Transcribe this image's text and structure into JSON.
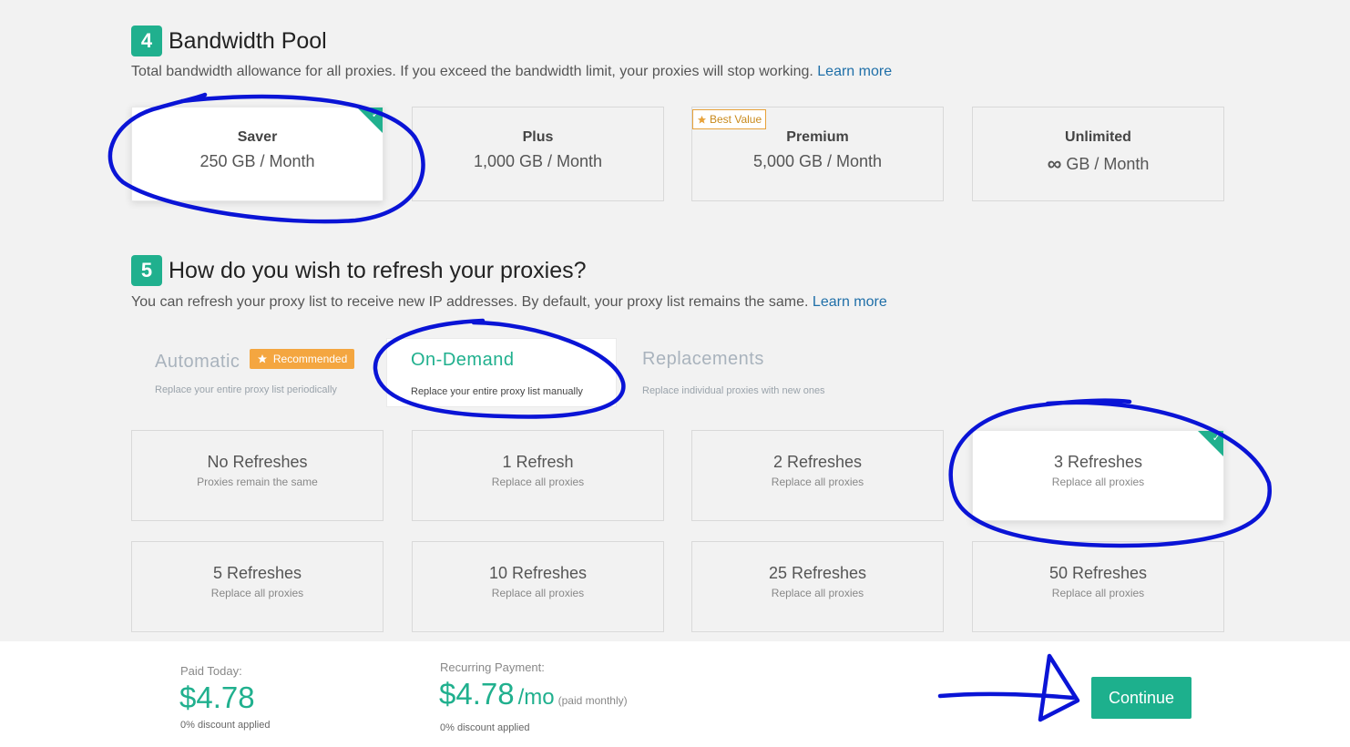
{
  "bandwidth": {
    "step": "4",
    "title": "Bandwidth Pool",
    "description": "Total bandwidth allowance for all proxies. If you exceed the bandwidth limit, your proxies will stop working.",
    "learn_more": "Learn more",
    "best_value_label": "Best Value",
    "plans": [
      {
        "name": "Saver",
        "amount": "250 GB / Month",
        "selected": true
      },
      {
        "name": "Plus",
        "amount": "1,000 GB / Month",
        "selected": false
      },
      {
        "name": "Premium",
        "amount": "5,000 GB / Month",
        "selected": false
      },
      {
        "name": "Unlimited",
        "amount_icon": "infinity-icon",
        "amount_text": "GB / Month",
        "selected": false
      }
    ]
  },
  "refresh": {
    "step": "5",
    "title": "How do you wish to refresh your proxies?",
    "description": "You can refresh your proxy list to receive new IP addresses. By default, your proxy list remains the same.",
    "learn_more": "Learn more",
    "tabs": [
      {
        "label": "Automatic",
        "sub": "Replace your entire proxy list periodically",
        "badge": "Recommended",
        "active": false
      },
      {
        "label": "On-Demand",
        "sub": "Replace your entire proxy list manually",
        "active": true
      },
      {
        "label": "Replacements",
        "sub": "Replace individual proxies with new ones",
        "active": false
      }
    ],
    "options": [
      {
        "name": "No Refreshes",
        "sub": "Proxies remain the same",
        "selected": false
      },
      {
        "name": "1 Refresh",
        "sub": "Replace all proxies",
        "selected": false
      },
      {
        "name": "2 Refreshes",
        "sub": "Replace all proxies",
        "selected": false
      },
      {
        "name": "3 Refreshes",
        "sub": "Replace all proxies",
        "selected": true
      },
      {
        "name": "5 Refreshes",
        "sub": "Replace all proxies",
        "selected": false
      },
      {
        "name": "10 Refreshes",
        "sub": "Replace all proxies",
        "selected": false
      },
      {
        "name": "25 Refreshes",
        "sub": "Replace all proxies",
        "selected": false
      },
      {
        "name": "50 Refreshes",
        "sub": "Replace all proxies",
        "selected": false
      }
    ]
  },
  "footer": {
    "paid_today_label": "Paid Today:",
    "paid_today_amount": "$4.78",
    "paid_today_discount": "0% discount applied",
    "recurring_label": "Recurring Payment:",
    "recurring_amount": "$4.78",
    "recurring_unit": "/mo",
    "recurring_note": "(paid monthly)",
    "recurring_discount": "0% discount applied",
    "continue_label": "Continue"
  },
  "colors": {
    "accent": "#20b08e",
    "annotation": "#0a14d6",
    "badge_orange": "#f4a640"
  }
}
